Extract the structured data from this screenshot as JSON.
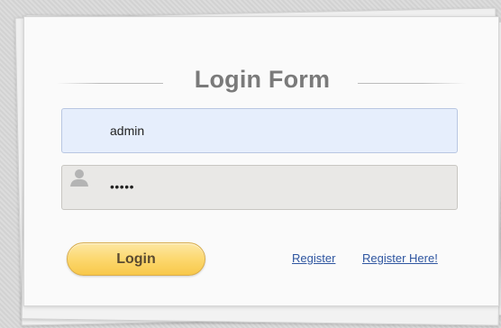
{
  "form": {
    "title": "Login Form",
    "username_value": "admin",
    "password_value": "•••••",
    "login_label": "Login",
    "register_label": "Register",
    "register_here_label": "Register Here!"
  },
  "icons": {
    "password_field_icon": "user-icon"
  },
  "colors": {
    "username_field_bg": "#e6eefc",
    "password_field_bg": "#e9e8e6",
    "login_button": "#fcd86f",
    "link": "#2f56a0",
    "title": "#7a7a7a"
  }
}
